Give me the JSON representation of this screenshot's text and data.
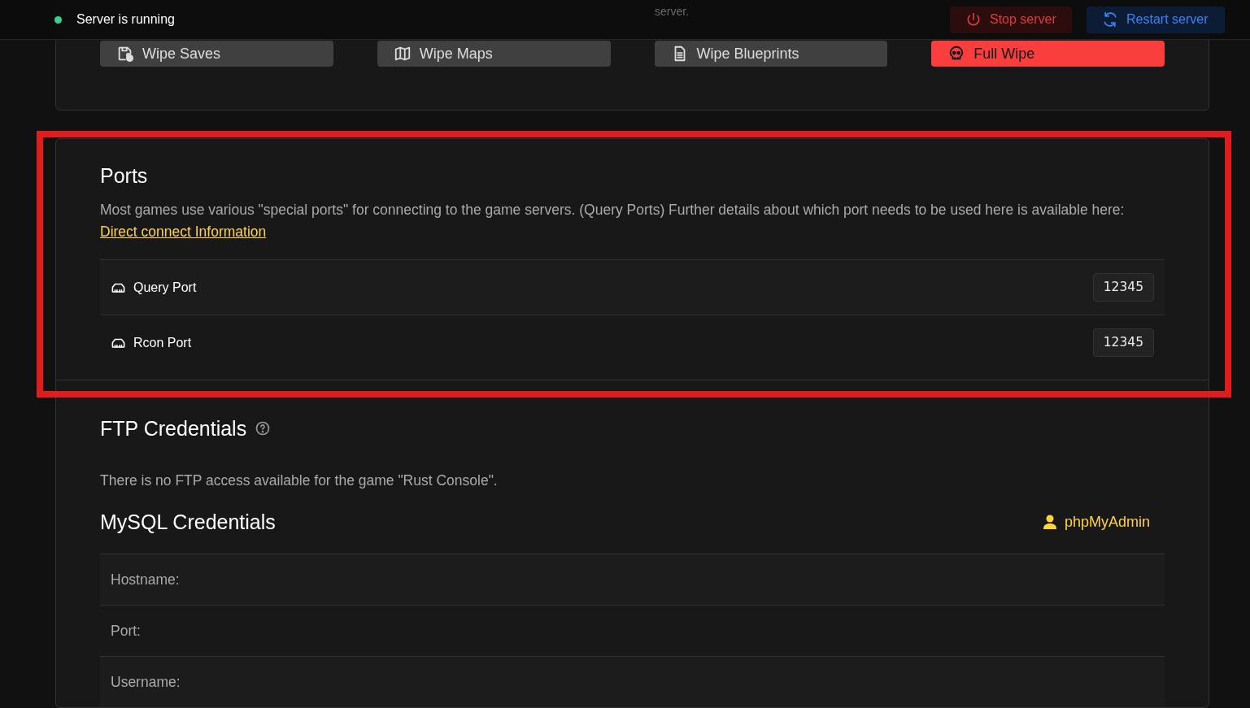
{
  "status_bar": {
    "text": "Server is running",
    "running": true
  },
  "header_actions": [
    {
      "label": "Stop server",
      "kind": "stop"
    },
    {
      "label": "Restart server",
      "kind": "restart"
    }
  ],
  "wipe_card": {
    "description_tail": "server.",
    "buttons": [
      {
        "label": "Wipe Saves",
        "kind": "saves"
      },
      {
        "label": "Wipe Maps",
        "kind": "maps"
      },
      {
        "label": "Wipe Blueprints",
        "kind": "blueprints"
      },
      {
        "label": "Full Wipe",
        "kind": "full"
      }
    ]
  },
  "ports": {
    "title": "Ports",
    "highlighted": true,
    "description": "Most games use various \"special ports\" for connecting to the game servers. (Query Ports) Further details about which port needs to be used here is available here:",
    "link": "Direct connect Information",
    "rows": [
      {
        "label": "Query Port",
        "value": "12345"
      },
      {
        "label": "Rcon Port",
        "value": "12345"
      }
    ]
  },
  "ftp": {
    "title": "FTP Credentials",
    "message": "There is no FTP access available for the game \"Rust Console\"."
  },
  "mysql": {
    "title": "MySQL Credentials",
    "link": "phpMyAdmin",
    "rows": [
      {
        "label": "Hostname:"
      },
      {
        "label": "Port:"
      },
      {
        "label": "Username:"
      }
    ]
  }
}
